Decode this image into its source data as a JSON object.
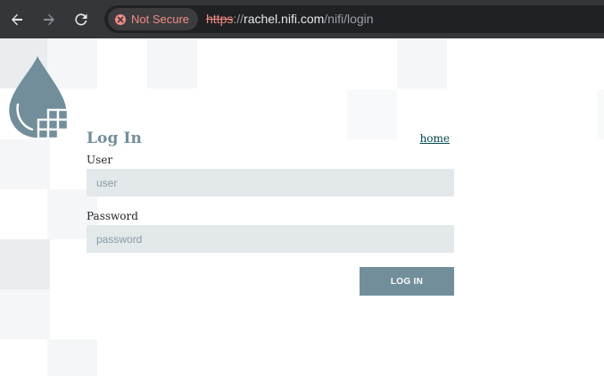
{
  "browser": {
    "security_label": "Not Secure",
    "url_scheme": "https",
    "url_separator": "://",
    "url_host": "rachel.nifi.com",
    "url_path": "/nifi/login",
    "icons": {
      "back": "back-arrow-icon",
      "forward": "forward-arrow-icon",
      "reload": "reload-icon",
      "security": "not-secure-warning-icon"
    }
  },
  "login": {
    "title": "Log In",
    "home_link": "home",
    "user_label": "User",
    "user_placeholder": "user",
    "user_value": "",
    "password_label": "Password",
    "password_placeholder": "password",
    "password_value": "",
    "submit_label": "LOG IN"
  },
  "colors": {
    "browser_bar": "#35363a",
    "omnibox": "#202124",
    "insecure": "#f28b82",
    "nifi_accent": "#728e9b",
    "input_bg": "#e3e8eb",
    "link": "#004849"
  },
  "brand": {
    "logo_icon": "nifi-drop-logo-icon"
  }
}
